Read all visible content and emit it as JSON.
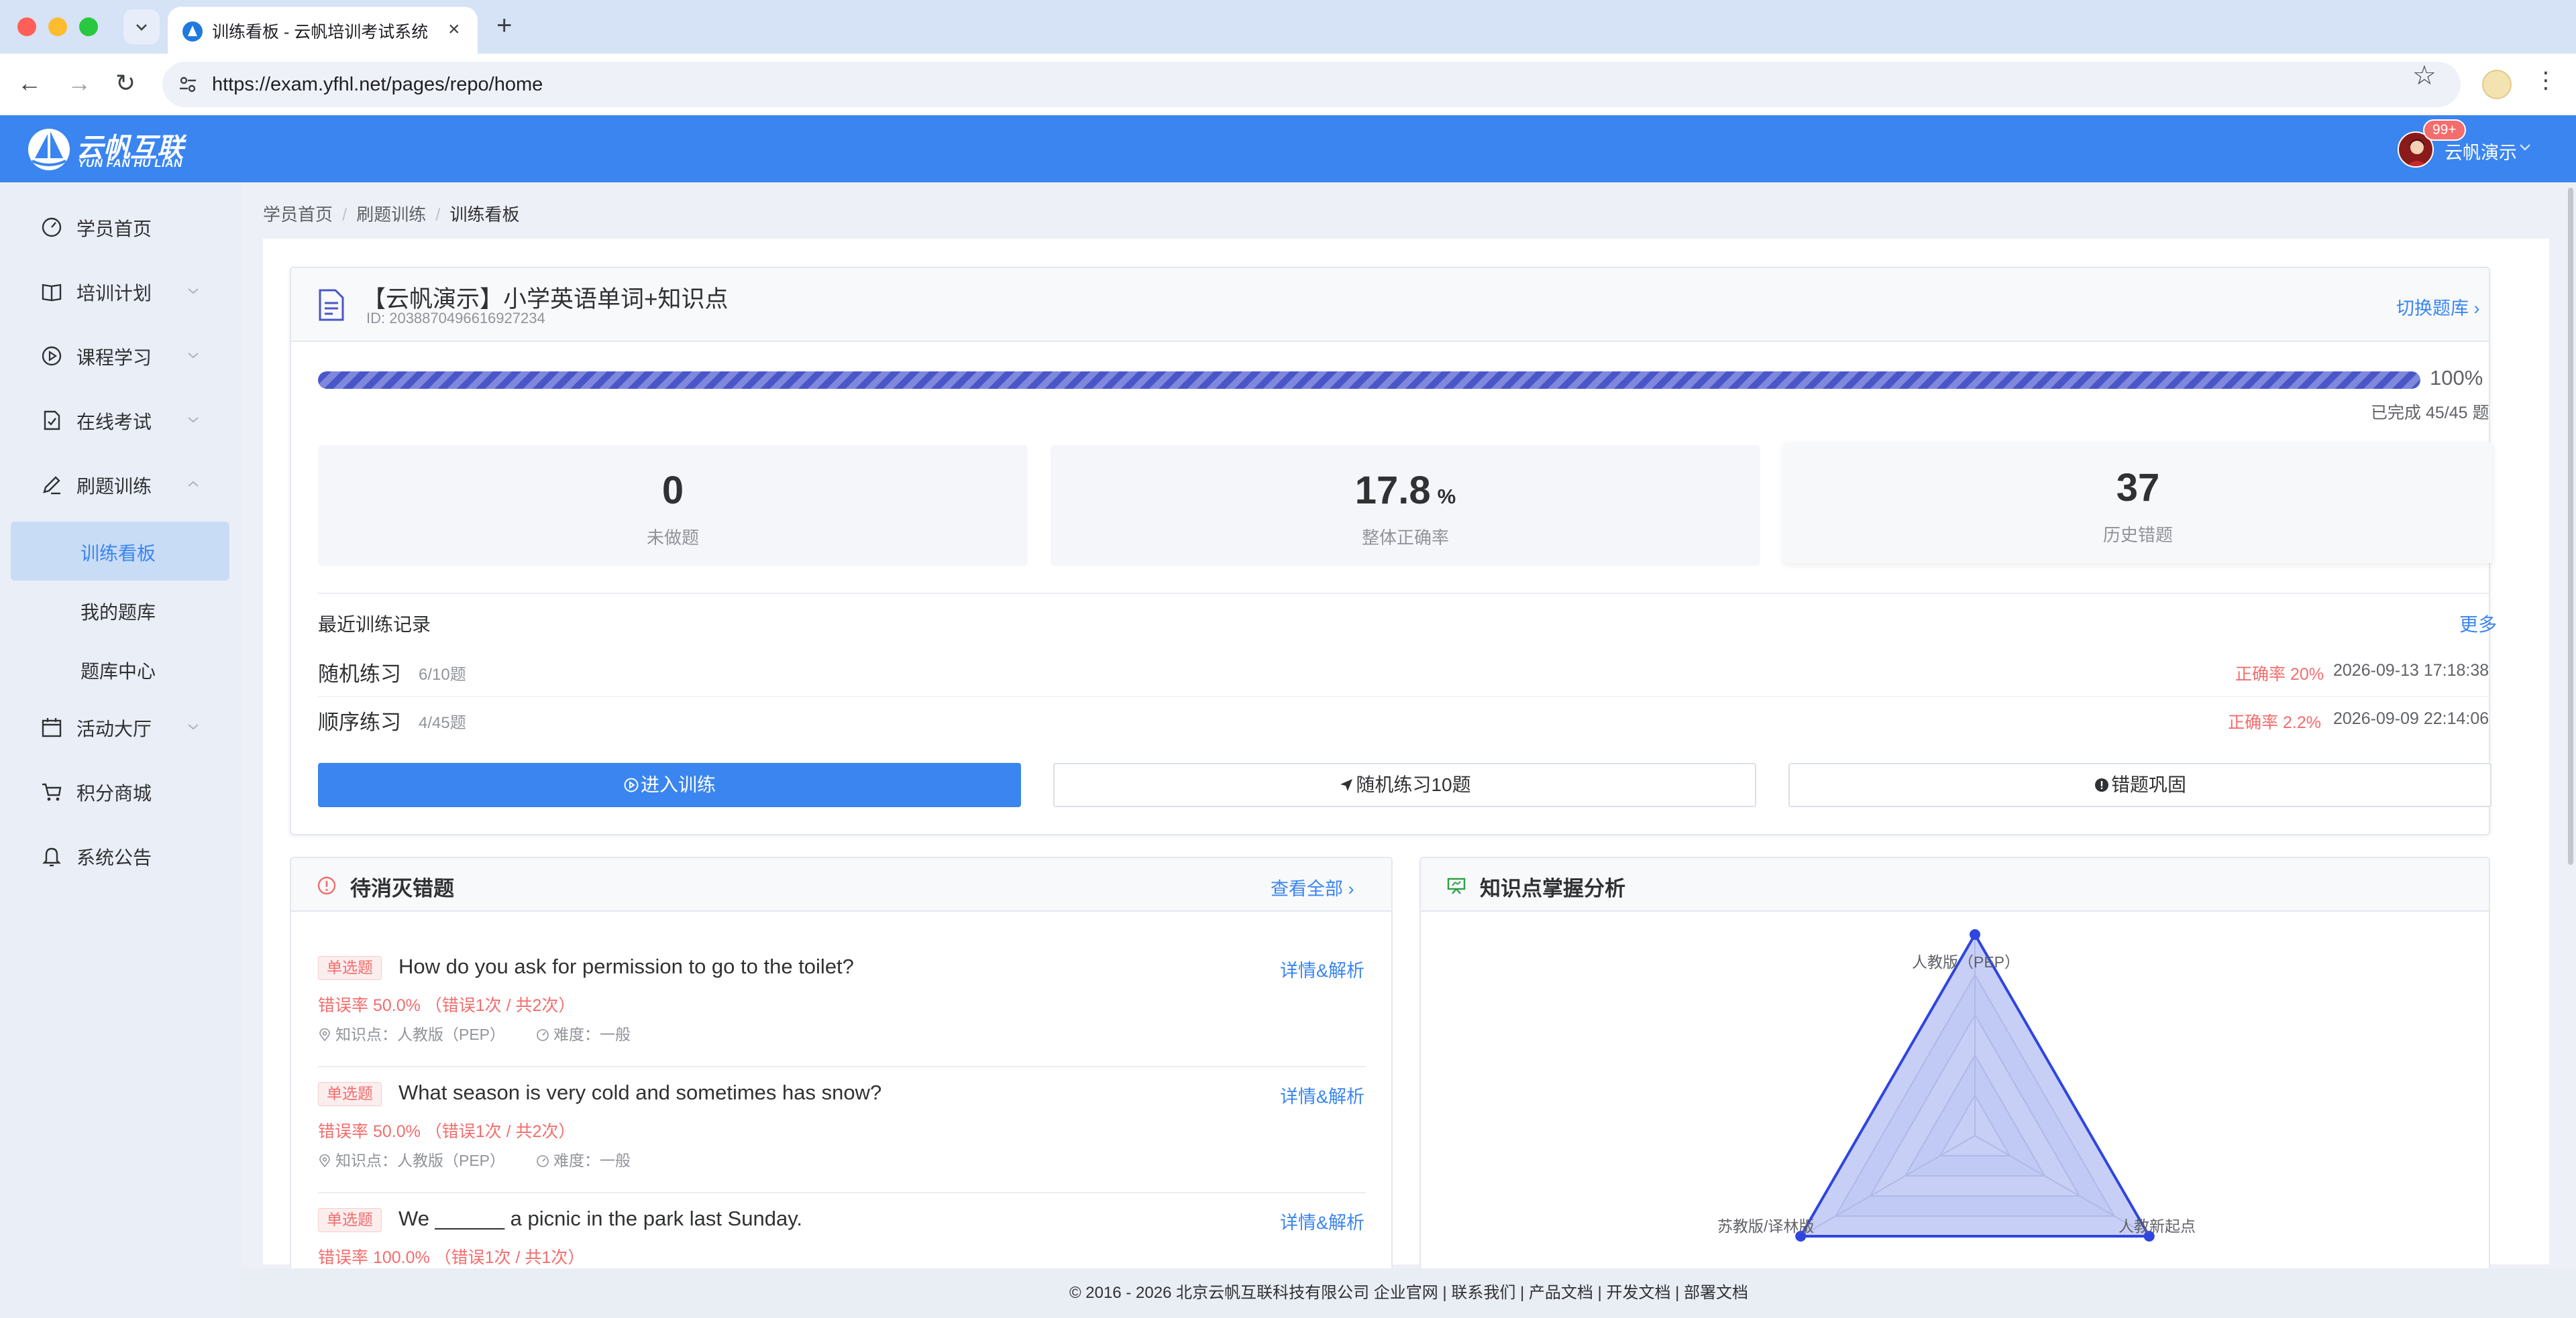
{
  "browser": {
    "tab_title": "训练看板 - 云帆培训考试系统",
    "url": "https://exam.yfhl.net/pages/repo/home",
    "new_tab": "+",
    "close_tab": "×"
  },
  "header": {
    "logo_cn": "云帆互联",
    "logo_en": "YUN FAN HU LIAN",
    "badge": "99+",
    "user_name": "云帆演示"
  },
  "sidebar": {
    "items": [
      {
        "label": "学员首页",
        "icon": "dashboard-icon"
      },
      {
        "label": "培训计划",
        "icon": "book-icon"
      },
      {
        "label": "课程学习",
        "icon": "play-circle-icon"
      },
      {
        "label": "在线考试",
        "icon": "exam-doc-icon"
      },
      {
        "label": "刷题训练",
        "icon": "pen-icon"
      },
      {
        "label": "活动大厅",
        "icon": "calendar-icon"
      },
      {
        "label": "积分商城",
        "icon": "cart-icon"
      },
      {
        "label": "系统公告",
        "icon": "bell-icon"
      }
    ],
    "sub_items": [
      "训练看板",
      "我的题库",
      "题库中心"
    ]
  },
  "breadcrumb": [
    "学员首页",
    "刷题训练",
    "训练看板"
  ],
  "repo": {
    "title": "【云帆演示】小学英语单词+知识点",
    "id": "ID: 2038870496616927234",
    "switch_label": "切换题库",
    "progress": 1.0,
    "progress_label": "100%",
    "completed_label": "已完成 45/45 题"
  },
  "stats": [
    {
      "value": "0",
      "unit": "",
      "label": "未做题"
    },
    {
      "value": "17.8",
      "unit": "%",
      "label": "整体正确率"
    },
    {
      "value": "37",
      "unit": "",
      "label": "历史错题"
    }
  ],
  "recent": {
    "title": "最近训练记录",
    "more": "更多",
    "records": [
      {
        "name": "随机练习",
        "count": "6/10题",
        "accuracy": "正确率 20%",
        "time": "2026-09-13 17:18:38"
      },
      {
        "name": "顺序练习",
        "count": "4/45题",
        "accuracy": "正确率 2.2%",
        "time": "2026-09-09 22:14:06"
      }
    ]
  },
  "actions": {
    "enter": "进入训练",
    "random": "随机练习10题",
    "wrong": "错题巩固"
  },
  "wrong_questions": {
    "title": "待消灭错题",
    "view_all": "查看全部",
    "detail_label": "详情&解析",
    "items": [
      {
        "tag": "单选题",
        "text": "How do you ask for permission to go to the toilet?",
        "error": "错误率 50.0%  （错误1次 / 共2次）",
        "knowledge": "知识点：人教版（PEP）",
        "difficulty": "难度：一般"
      },
      {
        "tag": "单选题",
        "text": "What season is very cold and sometimes has snow?",
        "error": "错误率 50.0%  （错误1次 / 共2次）",
        "knowledge": "知识点：人教版（PEP）",
        "difficulty": "难度：一般"
      },
      {
        "tag": "单选题",
        "text": "We ______ a picnic in the park last Sunday.",
        "error": "错误率 100.0%  （错误1次 / 共1次）",
        "knowledge": "",
        "difficulty": ""
      }
    ]
  },
  "knowledge": {
    "title": "知识点掌握分析",
    "chart_data": {
      "type": "radar",
      "indicators": [
        "人教版（PEP）",
        "人教新起点",
        "苏教版/译林版"
      ],
      "values": [
        1.0,
        1.0,
        1.0
      ],
      "max": 1.0,
      "rings": 5
    }
  },
  "footer": "© 2016 - 2026 北京云帆互联科技有限公司 企业官网 | 联系我们 | 产品文档 | 开发文档 | 部署文档",
  "colors": {
    "brand": "#3a85f0",
    "danger": "#f56c6c",
    "radar_line": "#2f45e0"
  }
}
